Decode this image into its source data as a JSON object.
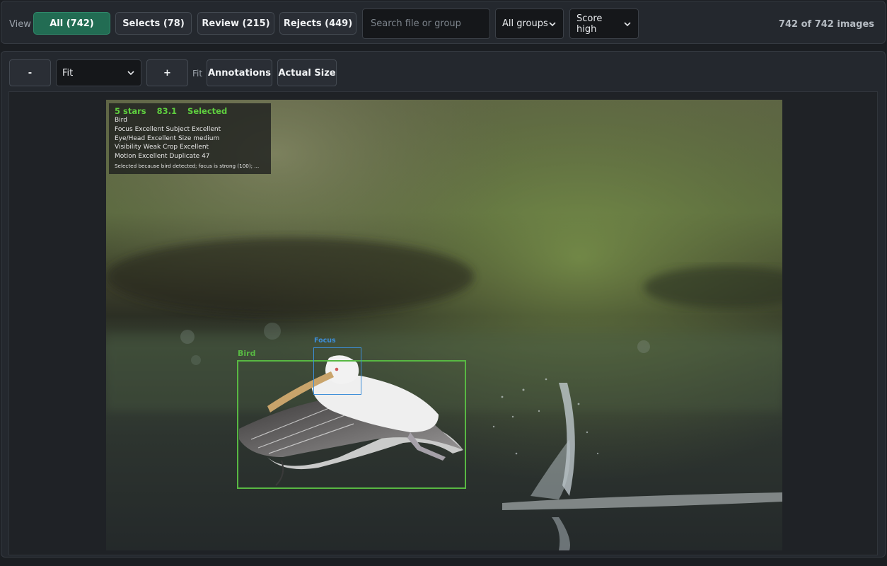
{
  "toolbar": {
    "view_label": "View",
    "tabs": [
      {
        "label": "All (742)",
        "active": true
      },
      {
        "label": "Selects (78)",
        "active": false
      },
      {
        "label": "Review (215)",
        "active": false
      },
      {
        "label": "Rejects (449)",
        "active": false
      }
    ],
    "search": {
      "placeholder": "Search file or group",
      "value": ""
    },
    "group_filter": {
      "selected": "All groups",
      "icon": "chevron-down-icon"
    },
    "sort": {
      "selected": "Score high",
      "icon": "chevron-down-icon"
    },
    "count_text": "742 of 742 images"
  },
  "viewer": {
    "zoom_out_label": "-",
    "zoom_select": "Fit",
    "zoom_in_label": "+",
    "fit_label": "Fit",
    "annotations_label": "Annotations",
    "actual_size_label": "Actual Size",
    "overlay": {
      "rating": "5 stars",
      "score": "83.1",
      "status": "Selected",
      "subject": "Bird",
      "lines": [
        "Focus Excellent  Subject Excellent",
        "Eye/Head Excellent  Size medium",
        "Visibility Weak  Crop Excellent",
        "Motion Excellent  Duplicate 47"
      ],
      "reason": "Selected because bird detected; focus is strong (100); ..."
    },
    "boxes": {
      "bird_label": "Bird",
      "focus_label": "Focus"
    },
    "colors": {
      "accent": "#226c53",
      "bird_box": "#58b843",
      "focus_box": "#3d8ed8",
      "overlay_text": "#5fcf3f"
    }
  }
}
